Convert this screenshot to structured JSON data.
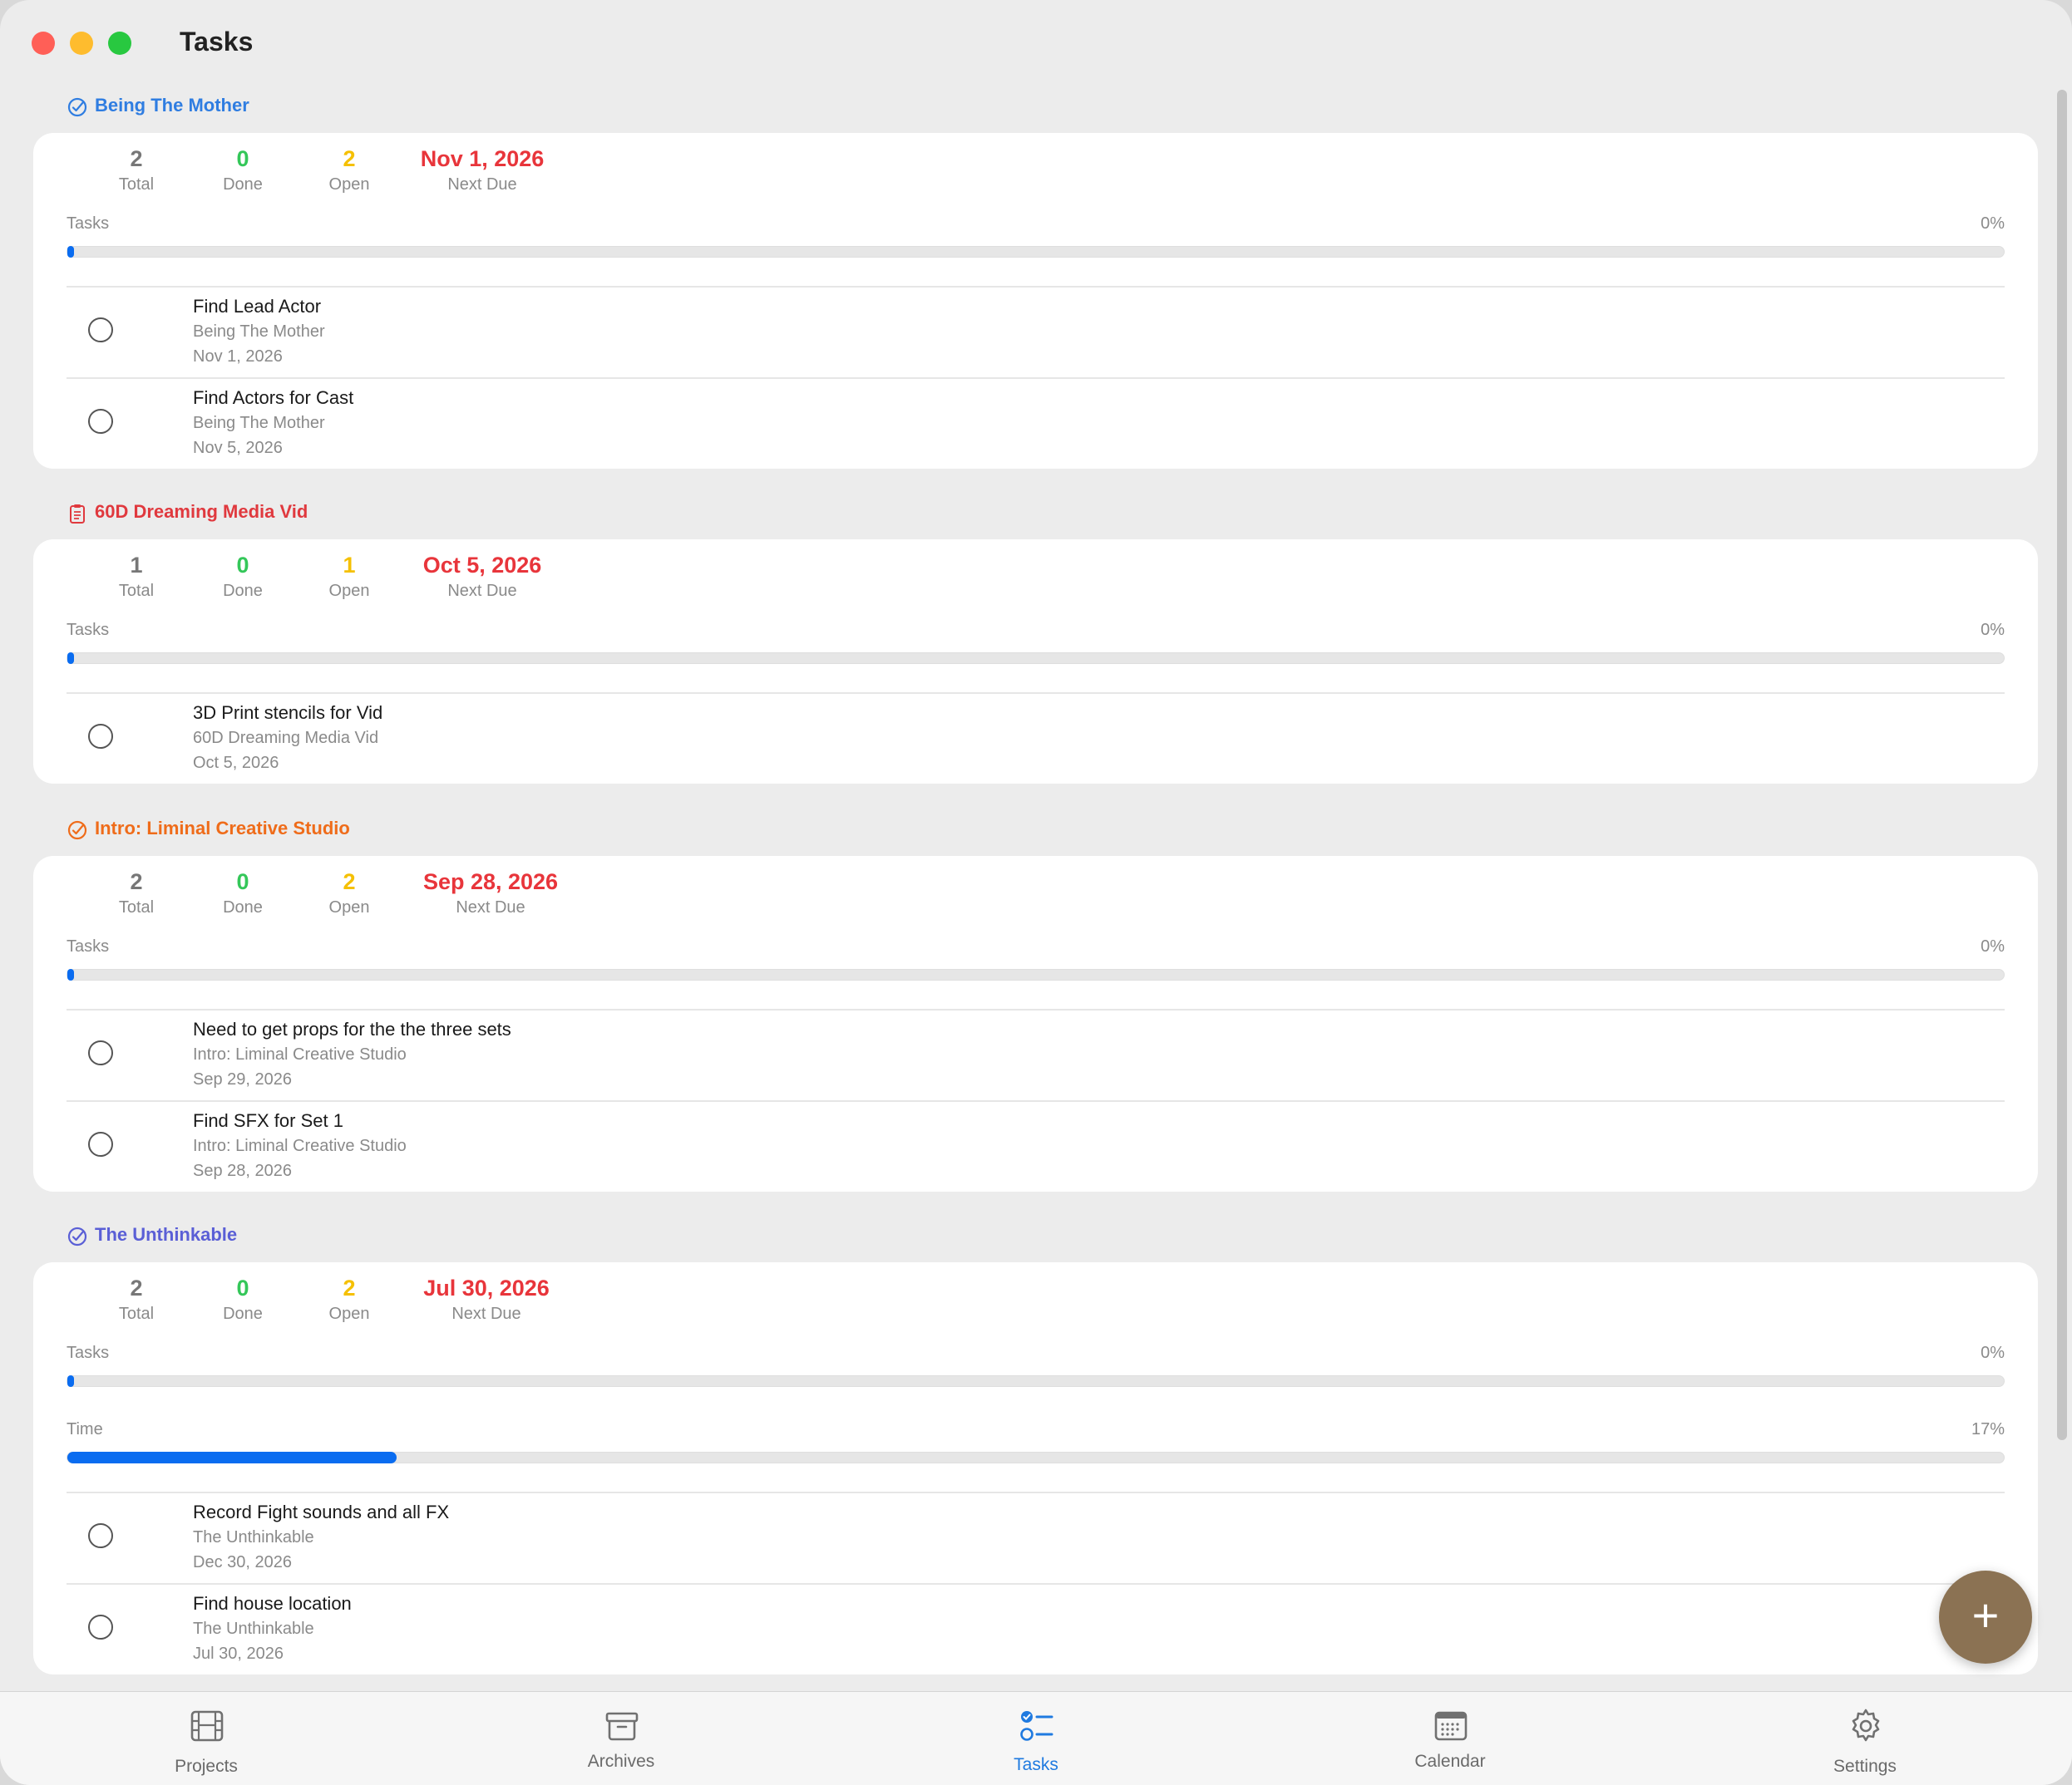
{
  "window": {
    "title": "Tasks"
  },
  "projects": [
    {
      "name": "Being The Mother",
      "color": "#2f7de1",
      "icon": "checkmark-circle-icon",
      "stats": {
        "total": "2",
        "total_label": "Total",
        "done": "0",
        "done_label": "Done",
        "open": "2",
        "open_label": "Open",
        "next_due": "Nov 1, 2026",
        "next_due_label": "Next Due"
      },
      "tasks_progress": {
        "label": "Tasks",
        "percent_text": "0%",
        "value": 0
      },
      "tasks": [
        {
          "name": "Find Lead Actor",
          "project": "Being The Mother",
          "date": "Nov 1, 2026"
        },
        {
          "name": "Find Actors for Cast",
          "project": "Being The Mother",
          "date": "Nov 5, 2026"
        }
      ]
    },
    {
      "name": "60D Dreaming Media Vid",
      "color": "#e0393e",
      "icon": "clipboard-icon",
      "stats": {
        "total": "1",
        "total_label": "Total",
        "done": "0",
        "done_label": "Done",
        "open": "1",
        "open_label": "Open",
        "next_due": "Oct 5, 2026",
        "next_due_label": "Next Due"
      },
      "tasks_progress": {
        "label": "Tasks",
        "percent_text": "0%",
        "value": 0
      },
      "tasks": [
        {
          "name": "3D Print stencils for Vid",
          "project": "60D Dreaming Media Vid",
          "date": "Oct 5, 2026"
        }
      ]
    },
    {
      "name": "Intro: Liminal Creative Studio",
      "color": "#ef6c1a",
      "icon": "checkmark-circle-icon",
      "stats": {
        "total": "2",
        "total_label": "Total",
        "done": "0",
        "done_label": "Done",
        "open": "2",
        "open_label": "Open",
        "next_due": "Sep 28, 2026",
        "next_due_label": "Next Due"
      },
      "tasks_progress": {
        "label": "Tasks",
        "percent_text": "0%",
        "value": 0
      },
      "tasks": [
        {
          "name": "Need to get props for the the three sets",
          "project": "Intro: Liminal Creative Studio",
          "date": "Sep 29, 2026"
        },
        {
          "name": "Find SFX for Set 1",
          "project": "Intro: Liminal Creative Studio",
          "date": "Sep 28, 2026"
        }
      ]
    },
    {
      "name": "The Unthinkable",
      "color": "#5a5fd6",
      "icon": "checkmark-circle-icon",
      "stats": {
        "total": "2",
        "total_label": "Total",
        "done": "0",
        "done_label": "Done",
        "open": "2",
        "open_label": "Open",
        "next_due": "Jul 30, 2026",
        "next_due_label": "Next Due"
      },
      "tasks_progress": {
        "label": "Tasks",
        "percent_text": "0%",
        "value": 0
      },
      "time_progress": {
        "label": "Time",
        "percent_text": "17%",
        "value": 0.17
      },
      "tasks": [
        {
          "name": "Record Fight sounds and all FX",
          "project": "The Unthinkable",
          "date": "Dec 30, 2026"
        },
        {
          "name": "Find house location",
          "project": "The Unthinkable",
          "date": "Jul 30, 2026"
        }
      ]
    }
  ],
  "fab": {
    "icon": "plus-icon",
    "glyph": "+"
  },
  "tabbar": {
    "items": [
      {
        "label": "Projects",
        "icon": "film-icon",
        "active": false
      },
      {
        "label": "Archives",
        "icon": "archive-box-icon",
        "active": false
      },
      {
        "label": "Tasks",
        "icon": "checklist-icon",
        "active": true
      },
      {
        "label": "Calendar",
        "icon": "calendar-icon",
        "active": false
      },
      {
        "label": "Settings",
        "icon": "gear-icon",
        "active": false
      }
    ]
  },
  "colors": {
    "accent": "#1f7ae0",
    "progress": "#0a6cf0",
    "fab": "#8b7253"
  }
}
